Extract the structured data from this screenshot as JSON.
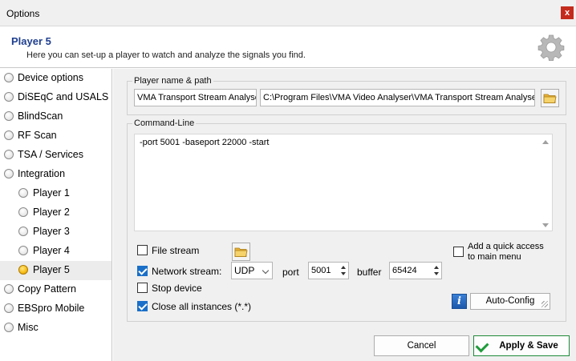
{
  "window": {
    "title": "Options",
    "close_glyph": "x"
  },
  "header": {
    "title": "Player 5",
    "subtitle": "Here you can set-up a player to watch and analyze the signals you find.",
    "icon": "gear-icon"
  },
  "sidebar": {
    "items": [
      {
        "label": "Device options"
      },
      {
        "label": "DiSEqC and USALS"
      },
      {
        "label": "BlindScan"
      },
      {
        "label": "RF Scan"
      },
      {
        "label": "TSA / Services"
      },
      {
        "label": "Integration"
      },
      {
        "label": "Player 1"
      },
      {
        "label": "Player 2"
      },
      {
        "label": "Player 3"
      },
      {
        "label": "Player 4"
      },
      {
        "label": "Player 5",
        "selected": true
      },
      {
        "label": "Copy Pattern"
      },
      {
        "label": "EBSpro Mobile"
      },
      {
        "label": "Misc"
      }
    ]
  },
  "player": {
    "group_label": "Player name & path",
    "name_value": "VMA Transport Stream Analyser",
    "path_value": "C:\\Program Files\\VMA Video Analyser\\VMA Transport Stream Analyser.exe"
  },
  "command": {
    "group_label": "Command-Line",
    "value": "-port 5001 -baseport 22000 -start"
  },
  "options": {
    "file_stream_label": "File stream",
    "file_stream_checked": false,
    "network_stream_label": "Network stream:",
    "network_stream_checked": true,
    "protocol": "UDP",
    "port_label": "port",
    "port_value": "5001",
    "buffer_label": "buffer",
    "buffer_value": "65424",
    "stop_device_label": "Stop device",
    "stop_device_checked": false,
    "close_all_label": "Close all instances (*.*)",
    "close_all_checked": true,
    "quick_access_label_1": "Add a quick access",
    "quick_access_label_2": "to main menu",
    "quick_access_checked": false,
    "info_glyph": "i",
    "auto_config_label": "Auto-Config"
  },
  "footer": {
    "cancel_label": "Cancel",
    "apply_label": "Apply & Save"
  }
}
